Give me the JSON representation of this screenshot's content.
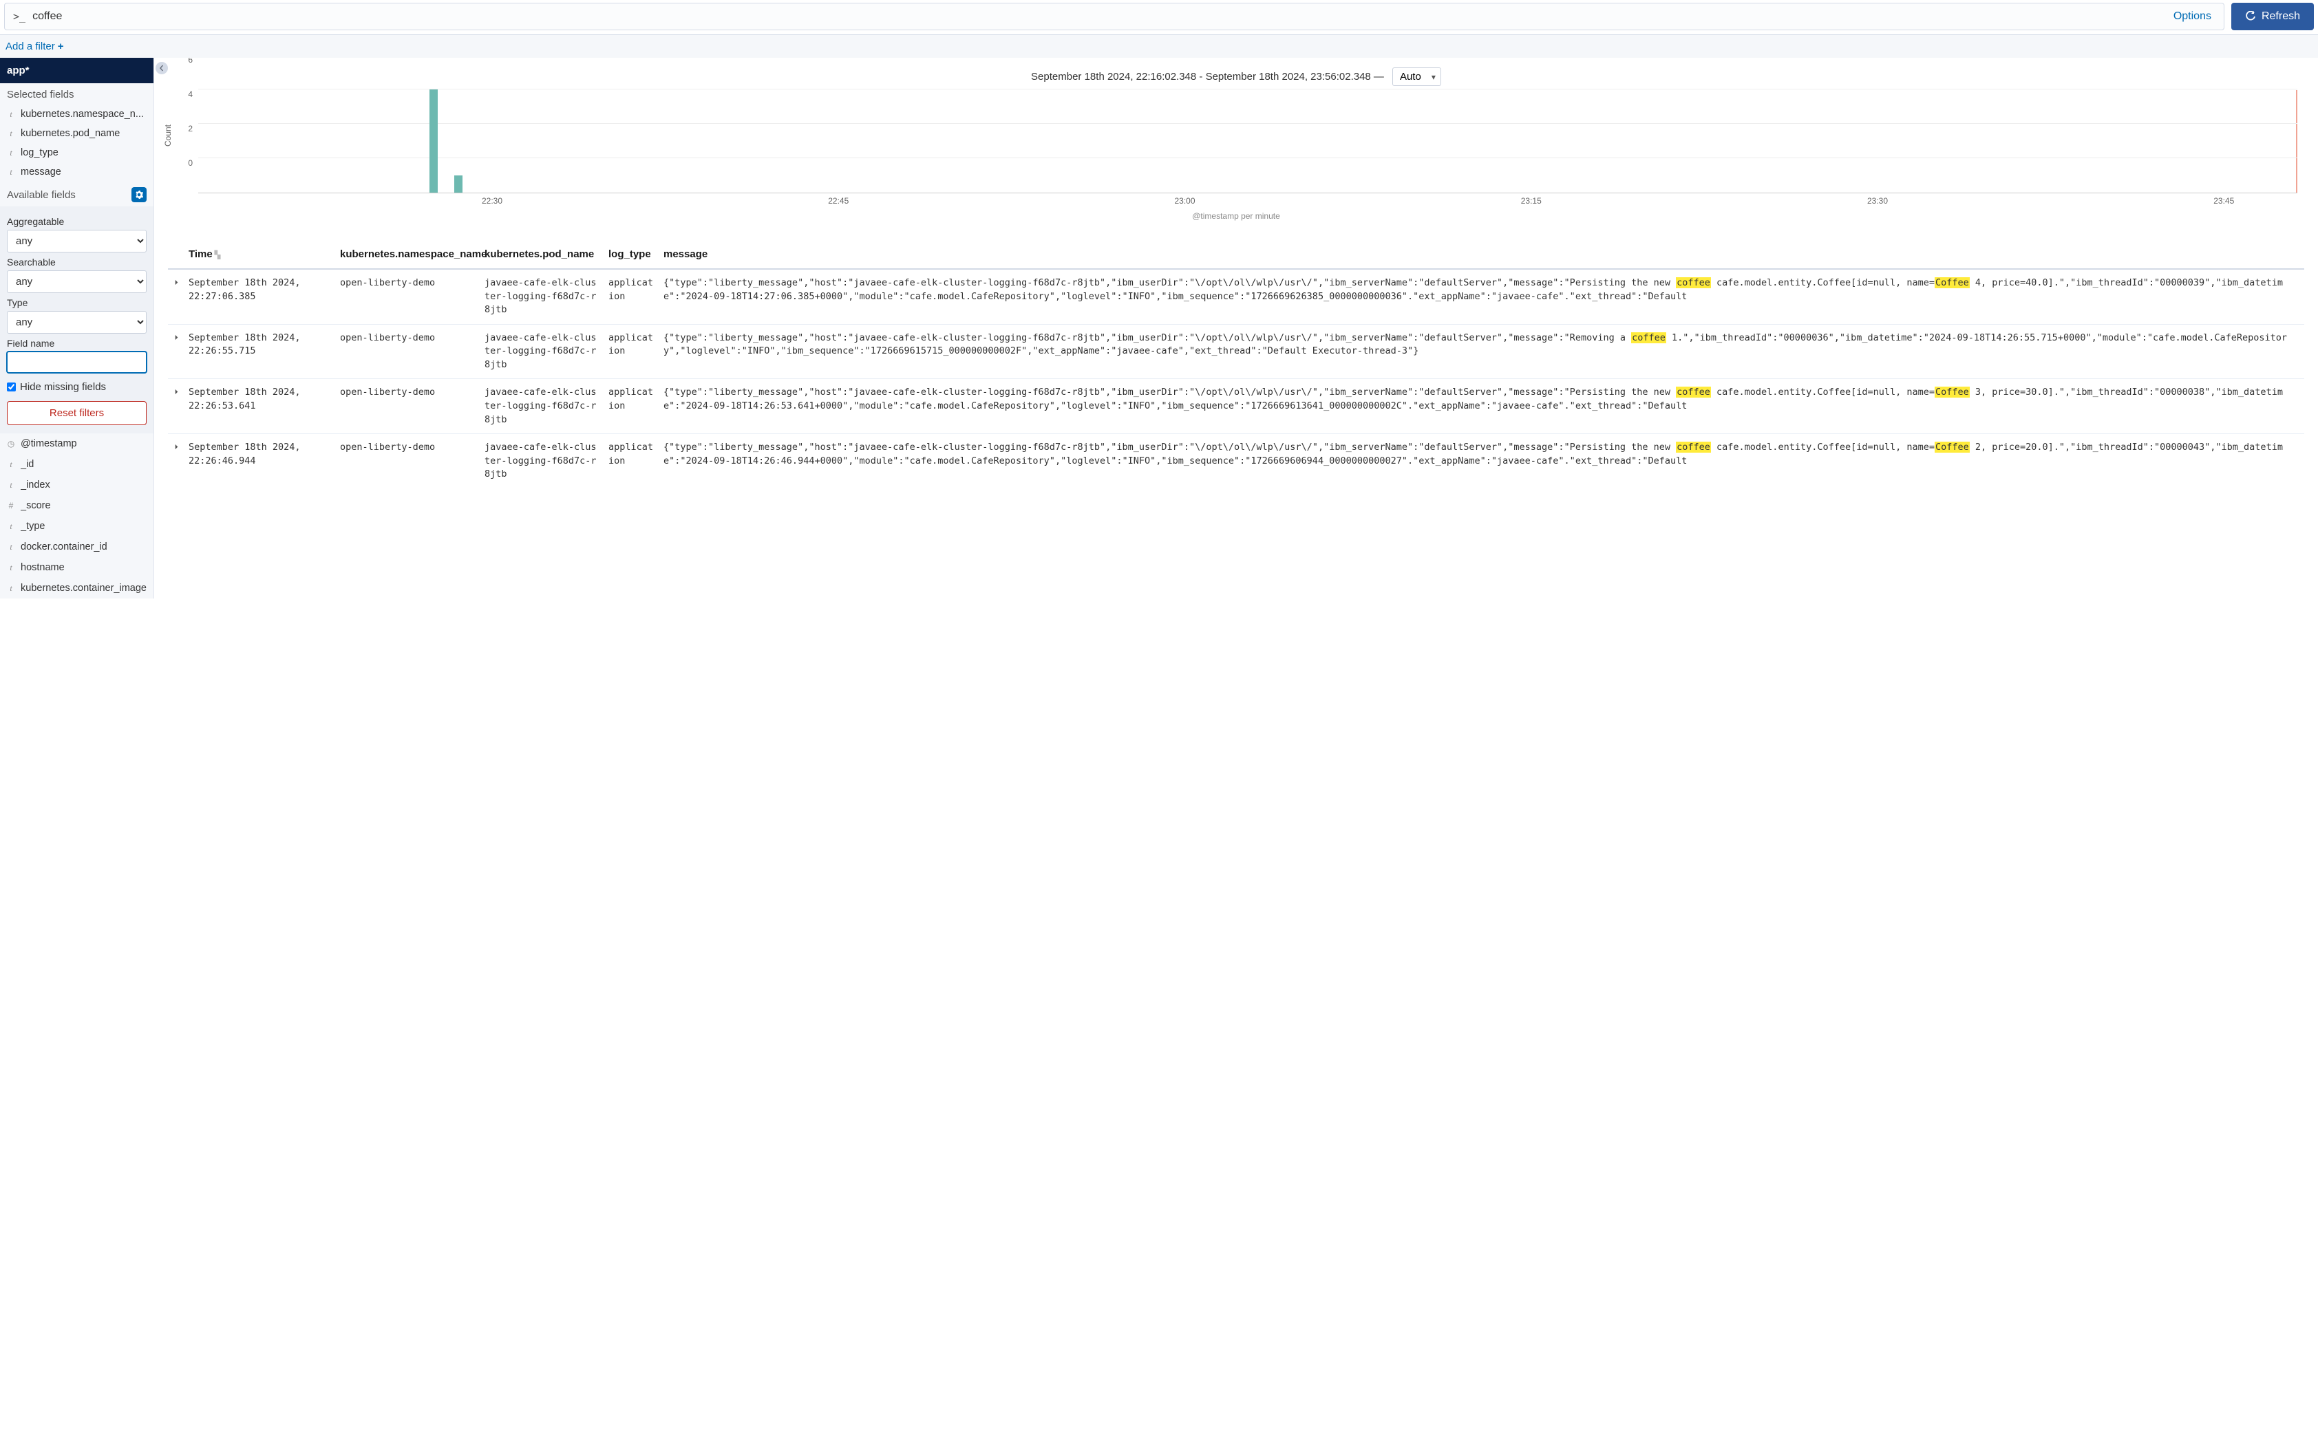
{
  "query": {
    "prompt": ">_",
    "value": "coffee",
    "options_label": "Options",
    "refresh_label": "Refresh"
  },
  "filter_bar": {
    "add_filter_label": "Add a filter"
  },
  "sidebar": {
    "index_pattern": "app*",
    "selected_fields_label": "Selected fields",
    "selected_fields": [
      {
        "type": "t",
        "name": "kubernetes.namespace_n..."
      },
      {
        "type": "t",
        "name": "kubernetes.pod_name"
      },
      {
        "type": "t",
        "name": "log_type"
      },
      {
        "type": "t",
        "name": "message"
      }
    ],
    "available_fields_label": "Available fields",
    "filter_panel": {
      "aggregatable_label": "Aggregatable",
      "aggregatable_value": "any",
      "searchable_label": "Searchable",
      "searchable_value": "any",
      "type_label": "Type",
      "type_value": "any",
      "field_name_label": "Field name",
      "field_name_value": "",
      "hide_missing_label": "Hide missing fields",
      "reset_label": "Reset filters"
    },
    "available_fields": [
      {
        "type": "clock",
        "name": "@timestamp"
      },
      {
        "type": "t",
        "name": "_id"
      },
      {
        "type": "t",
        "name": "_index"
      },
      {
        "type": "hash",
        "name": "_score"
      },
      {
        "type": "t",
        "name": "_type"
      },
      {
        "type": "t",
        "name": "docker.container_id"
      },
      {
        "type": "t",
        "name": "hostname"
      },
      {
        "type": "t",
        "name": "kubernetes.container_image"
      }
    ]
  },
  "time_header": {
    "range": "September 18th 2024, 22:16:02.348 - September 18th 2024, 23:56:02.348 —",
    "interval": "Auto"
  },
  "chart_data": {
    "type": "bar",
    "ylabel": "Count",
    "xlabel": "@timestamp per minute",
    "ylim": [
      0,
      6
    ],
    "yticks": [
      0,
      2,
      4,
      6
    ],
    "xticks": [
      "22:30",
      "22:45",
      "23:00",
      "23:15",
      "23:30",
      "23:45"
    ],
    "bars": [
      {
        "x_pct": 11.0,
        "value": 6
      },
      {
        "x_pct": 12.2,
        "value": 1
      }
    ]
  },
  "table": {
    "columns": {
      "time": "Time",
      "namespace": "kubernetes.namespace_name",
      "pod": "kubernetes.pod_name",
      "log_type": "log_type",
      "message": "message"
    },
    "rows": [
      {
        "time": "September 18th 2024, 22:27:06.385",
        "namespace": "open-liberty-demo",
        "pod": "javaee-cafe-elk-cluster-logging-f68d7c-r8jtb",
        "log_type": "application",
        "message_pre_hl1": "{\"type\":\"liberty_message\",\"host\":\"javaee-cafe-elk-cluster-logging-f68d7c-r8jtb\",\"ibm_userDir\":\"\\/opt\\/ol\\/wlp\\/usr\\/\",\"ibm_serverName\":\"defaultServer\",\"message\":\"Persisting the new ",
        "hl1": "coffee",
        "message_mid": " cafe.model.entity.Coffee[id=null, name=",
        "hl2": "Coffee",
        "message_post_hl2": " 4, price=40.0].\",\"ibm_threadId\":\"00000039\",\"ibm_datetime\":\"2024-09-18T14:27:06.385+0000\",\"module\":\"cafe.model.CafeRepository\",\"loglevel\":\"INFO\",\"ibm_sequence\":\"1726669626385_0000000000036\".\"ext_appName\":\"javaee-cafe\".\"ext_thread\":\"Default"
      },
      {
        "time": "September 18th 2024, 22:26:55.715",
        "namespace": "open-liberty-demo",
        "pod": "javaee-cafe-elk-cluster-logging-f68d7c-r8jtb",
        "log_type": "application",
        "message_pre_hl1": "{\"type\":\"liberty_message\",\"host\":\"javaee-cafe-elk-cluster-logging-f68d7c-r8jtb\",\"ibm_userDir\":\"\\/opt\\/ol\\/wlp\\/usr\\/\",\"ibm_serverName\":\"defaultServer\",\"message\":\"Removing a ",
        "hl1": "coffee",
        "message_mid": " 1.\",\"ibm_threadId\":\"00000036\",\"ibm_datetime\":\"2024-09-18T14:26:55.715+0000\",\"module\":\"cafe.model.CafeRepository\",\"loglevel\":\"INFO\",\"ibm_sequence\":\"1726669615715_000000000002F\",\"ext_appName\":\"javaee-cafe\",\"ext_thread\":\"Default Executor-thread-3\"}",
        "hl2": "",
        "message_post_hl2": ""
      },
      {
        "time": "September 18th 2024, 22:26:53.641",
        "namespace": "open-liberty-demo",
        "pod": "javaee-cafe-elk-cluster-logging-f68d7c-r8jtb",
        "log_type": "application",
        "message_pre_hl1": "{\"type\":\"liberty_message\",\"host\":\"javaee-cafe-elk-cluster-logging-f68d7c-r8jtb\",\"ibm_userDir\":\"\\/opt\\/ol\\/wlp\\/usr\\/\",\"ibm_serverName\":\"defaultServer\",\"message\":\"Persisting the new ",
        "hl1": "coffee",
        "message_mid": " cafe.model.entity.Coffee[id=null, name=",
        "hl2": "Coffee",
        "message_post_hl2": " 3, price=30.0].\",\"ibm_threadId\":\"00000038\",\"ibm_datetime\":\"2024-09-18T14:26:53.641+0000\",\"module\":\"cafe.model.CafeRepository\",\"loglevel\":\"INFO\",\"ibm_sequence\":\"1726669613641_000000000002C\".\"ext_appName\":\"javaee-cafe\".\"ext_thread\":\"Default"
      },
      {
        "time": "September 18th 2024, 22:26:46.944",
        "namespace": "open-liberty-demo",
        "pod": "javaee-cafe-elk-cluster-logging-f68d7c-r8jtb",
        "log_type": "application",
        "message_pre_hl1": "{\"type\":\"liberty_message\",\"host\":\"javaee-cafe-elk-cluster-logging-f68d7c-r8jtb\",\"ibm_userDir\":\"\\/opt\\/ol\\/wlp\\/usr\\/\",\"ibm_serverName\":\"defaultServer\",\"message\":\"Persisting the new ",
        "hl1": "coffee",
        "message_mid": " cafe.model.entity.Coffee[id=null, name=",
        "hl2": "Coffee",
        "message_post_hl2": " 2, price=20.0].\",\"ibm_threadId\":\"00000043\",\"ibm_datetime\":\"2024-09-18T14:26:46.944+0000\",\"module\":\"cafe.model.CafeRepository\",\"loglevel\":\"INFO\",\"ibm_sequence\":\"1726669606944_0000000000027\".\"ext_appName\":\"javaee-cafe\".\"ext_thread\":\"Default"
      }
    ]
  }
}
